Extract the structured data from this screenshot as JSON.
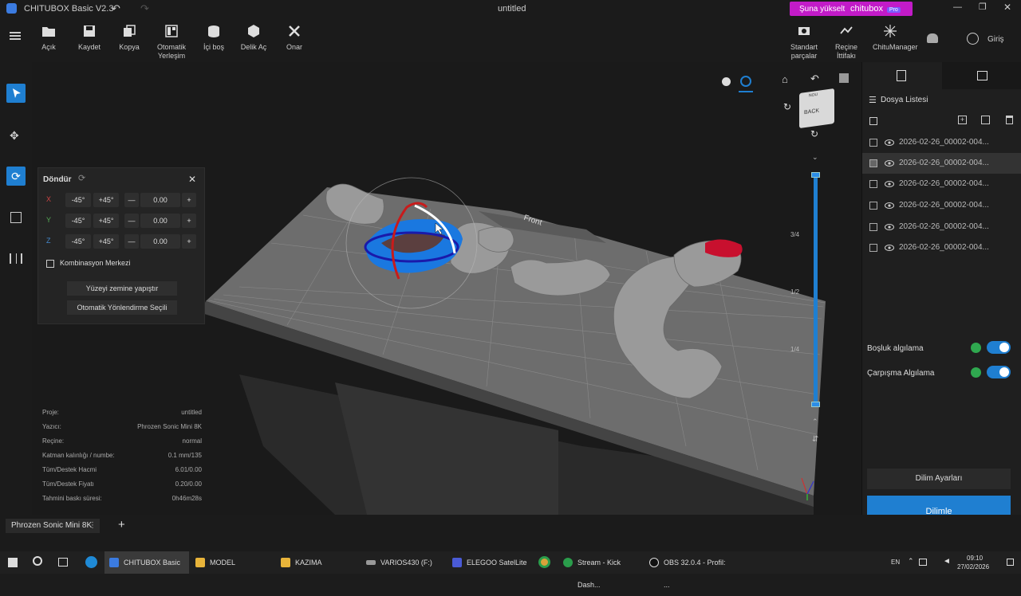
{
  "titlebar": {
    "app_title": "CHITUBOX Basic V2.3",
    "doc_title": "untitled",
    "upgrade_label": "Şuna yükselt",
    "upgrade_brand": "chitubox",
    "upgrade_badge": "Pro"
  },
  "toolbar": {
    "left": [
      {
        "label": "Açık",
        "icon": "folder-icon"
      },
      {
        "label": "Kaydet",
        "icon": "save-icon"
      },
      {
        "label": "Kopya",
        "icon": "copy-icon"
      },
      {
        "label": "Otomatik Yerleşim",
        "icon": "layout-icon"
      },
      {
        "label": "İçi boş",
        "icon": "hollow-icon"
      },
      {
        "label": "Delik Aç",
        "icon": "hole-icon"
      },
      {
        "label": "Onar",
        "icon": "repair-icon"
      }
    ],
    "right": [
      {
        "label": "Standart parçalar",
        "icon": "parts-icon"
      },
      {
        "label": "Reçine İttifakı",
        "icon": "resin-icon"
      },
      {
        "label": "ChituManager",
        "icon": "manager-icon"
      }
    ],
    "login_label": "Giriş"
  },
  "rotate_panel": {
    "title": "Döndür",
    "axes": [
      {
        "axis": "X",
        "minus": "-45°",
        "plus": "+45°",
        "value": "0.00",
        "color": "#c44"
      },
      {
        "axis": "Y",
        "minus": "-45°",
        "plus": "+45°",
        "value": "0.00",
        "color": "#5a5"
      },
      {
        "axis": "Z",
        "minus": "-45°",
        "plus": "+45°",
        "value": "0.00",
        "color": "#48c"
      }
    ],
    "combine_center_label": "Kombinasyon Merkezi",
    "lay_flat_label": "Yüzeyi zemine yapıştır",
    "auto_orient_label": "Otomatik Yönlendirme Seçili"
  },
  "info": [
    {
      "label": "Proje:",
      "value": "untitled"
    },
    {
      "label": "Yazıcı:",
      "value": "Phrozen Sonic Mini 8K"
    },
    {
      "label": "Reçine:",
      "value": "normal"
    },
    {
      "label": "Katman kalınlığı / numbe:",
      "value": "0.1 mm/135"
    },
    {
      "label": "Tüm/Destek Hacmi",
      "value": "6.01/0.00"
    },
    {
      "label": "Tüm/Destek Fiyatı",
      "value": "0.20/0.00"
    },
    {
      "label": "Tahmini baskı süresi:",
      "value": "0h46m28s"
    }
  ],
  "viewport": {
    "plate_label": "Front",
    "cube_labels": {
      "top": "NOU",
      "front": "BACK"
    },
    "slider_ticks": [
      "3/4",
      "1/2",
      "1/4"
    ]
  },
  "right_panel": {
    "file_list_title": "Dosya Listesi",
    "files": [
      {
        "name": "2026-02-26_00002-004...",
        "selected": false
      },
      {
        "name": "2026-02-26_00002-004...",
        "selected": true
      },
      {
        "name": "2026-02-26_00002-004...",
        "selected": false
      },
      {
        "name": "2026-02-26_00002-004...",
        "selected": false
      },
      {
        "name": "2026-02-26_00002-004...",
        "selected": false
      },
      {
        "name": "2026-02-26_00002-004...",
        "selected": false
      }
    ],
    "gap_detection_label": "Boşluk algılama",
    "collision_detection_label": "Çarpışma Algılama",
    "slice_settings_label": "Dilim Ayarları",
    "slice_button_label": "Dilimle"
  },
  "statusbar": {
    "printer_tab": "Phrozen Sonic Mini 8K",
    "add_label": "+"
  },
  "taskbar": {
    "items": [
      "CHITUBOX Basic",
      "MODEL",
      "KAZIMA",
      "VARIOS430 (F:)",
      "ELEGOO SatelLite",
      "Stream - Kick Dash...",
      "OBS 32.0.4 - Profil: ..."
    ],
    "lang": "EN",
    "time": "09:10",
    "date": "27/02/2026"
  },
  "colors": {
    "accent": "#1f7fd1",
    "upgrade_bg": "#c21bc8",
    "selected_model": "#1a78e0",
    "highlight_model": "#c8102e"
  }
}
